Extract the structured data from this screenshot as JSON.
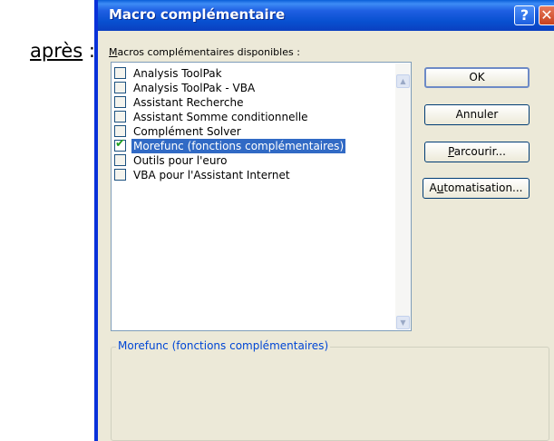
{
  "caption": {
    "word": "après",
    "suffix": " :"
  },
  "dialog": {
    "title": "Macro complémentaire",
    "help_button": "?",
    "close_button": "✕",
    "available_label_accel": "M",
    "available_label_rest": "acros complémentaires disponibles :",
    "items": [
      {
        "label": "Analysis ToolPak",
        "checked": false,
        "selected": false
      },
      {
        "label": "Analysis ToolPak - VBA",
        "checked": false,
        "selected": false
      },
      {
        "label": "Assistant Recherche",
        "checked": false,
        "selected": false
      },
      {
        "label": "Assistant Somme conditionnelle",
        "checked": false,
        "selected": false
      },
      {
        "label": "Complément Solver",
        "checked": false,
        "selected": false
      },
      {
        "label": "Morefunc (fonctions complémentaires)",
        "checked": true,
        "selected": true
      },
      {
        "label": "Outils pour l'euro",
        "checked": false,
        "selected": false
      },
      {
        "label": "VBA pour l'Assistant Internet",
        "checked": false,
        "selected": false
      }
    ],
    "buttons": {
      "ok": "OK",
      "cancel": "Annuler",
      "browse_accel": "P",
      "browse_rest": "arcourir...",
      "automation_pre": "A",
      "automation_accel": "u",
      "automation_rest": "tomatisation..."
    },
    "description_title": "Morefunc (fonctions complémentaires)",
    "colors": {
      "title_bar": "#0a50d0",
      "selection": "#316ac5",
      "check": "#21a121",
      "group_title": "#0046d5"
    }
  }
}
